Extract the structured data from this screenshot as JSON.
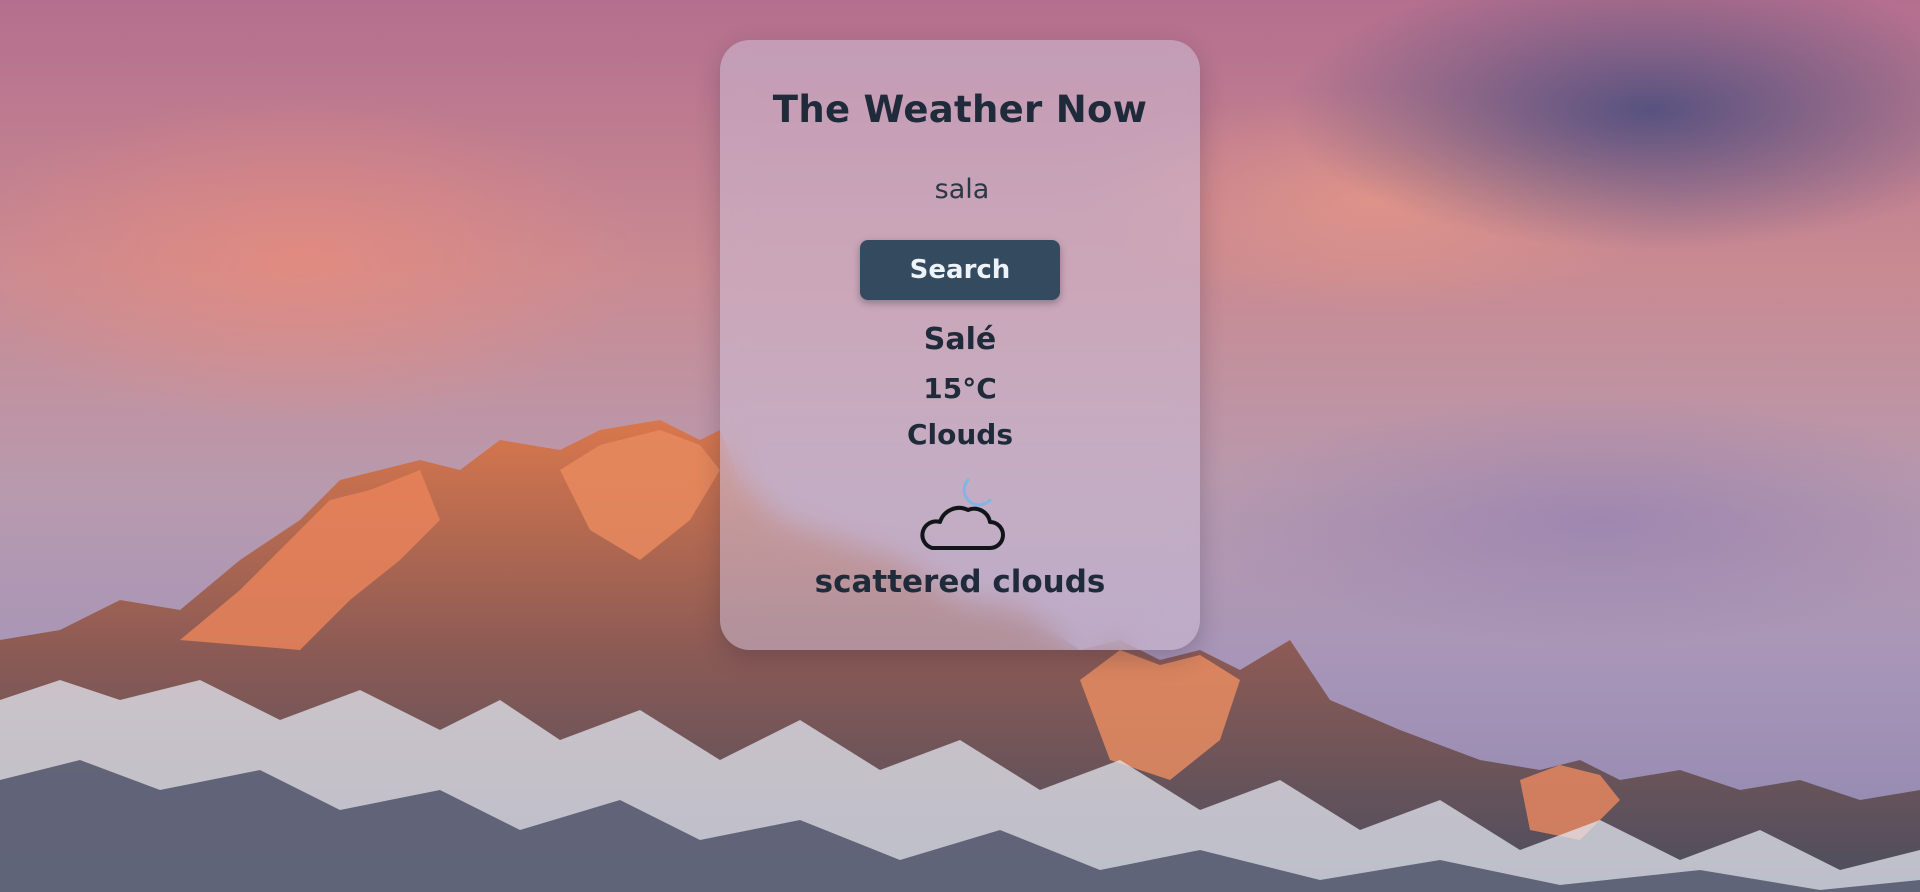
{
  "app": {
    "title": "The Weather Now"
  },
  "search": {
    "value": "sala",
    "button_label": "Search"
  },
  "weather": {
    "city": "Salé",
    "temperature": "15°C",
    "condition": "Clouds",
    "description": "scattered clouds",
    "icon": "night-cloud-icon"
  },
  "colors": {
    "button_bg": "#344a5f",
    "text": "#1f2a3a",
    "moon": "#7fb6e6"
  }
}
